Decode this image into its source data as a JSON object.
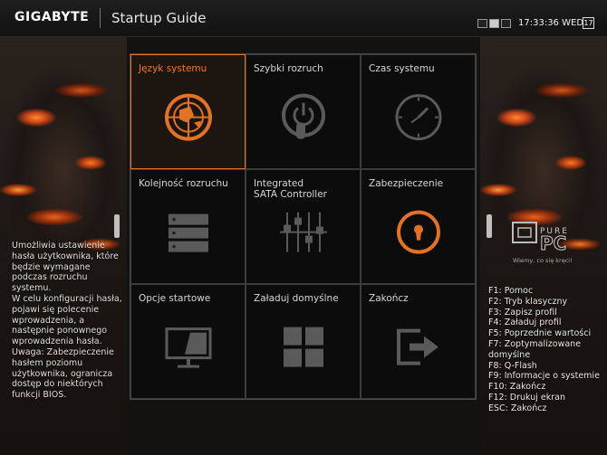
{
  "header": {
    "brand": "GIGABYTE",
    "title": "Startup Guide",
    "time": "17:33:36",
    "day": "WED",
    "calendar_day": "17"
  },
  "tiles": [
    {
      "label": "Język systemu",
      "icon": "language-globe-icon",
      "selected": true
    },
    {
      "label": "Szybki rozruch",
      "icon": "fast-boot-power-hand-icon",
      "selected": false
    },
    {
      "label": "Czas systemu",
      "icon": "clock-icon",
      "selected": false
    },
    {
      "label": "Kolejność rozruchu",
      "icon": "boot-order-stack-icon",
      "selected": false
    },
    {
      "label": "Integrated\nSATA Controller",
      "icon": "sata-sliders-icon",
      "selected": false
    },
    {
      "label": "Zabezpieczenie",
      "icon": "security-lock-icon",
      "selected": false
    },
    {
      "label": "Opcje startowe",
      "icon": "monitor-icon",
      "selected": false
    },
    {
      "label": "Załaduj domyślne",
      "icon": "load-defaults-grid-icon",
      "selected": false
    },
    {
      "label": "Zakończ",
      "icon": "exit-arrow-icon",
      "selected": false
    }
  ],
  "help_text": "Umożliwia ustawienie hasła użytkownika, które będzie wymagane podczas rozruchu systemu.\nW celu konfiguracji hasła, pojawi się polecenie wprowadzenia, a następnie ponownego wprowadzenia hasła.\nUwaga: Zabezpieczenie hasłem poziomu użytkownika, ogranicza dostęp do niektórych funkcji BIOS.",
  "keys": [
    "F1: Pomoc",
    "F2: Tryb klasyczny",
    "F3: Zapisz profil",
    "F4: Załaduj profil",
    "F5: Poprzednie wartości",
    "F7: Zoptymalizowane domyślne",
    "F8: Q-Flash",
    "F9: Informacje o systemie",
    "F10: Zakończ",
    "F12: Drukuj ekran",
    "ESC: Zakończ"
  ],
  "colors": {
    "accent": "#e27326",
    "tile_border": "#3c3c3c",
    "icon_gray": "#5a5a5a"
  }
}
